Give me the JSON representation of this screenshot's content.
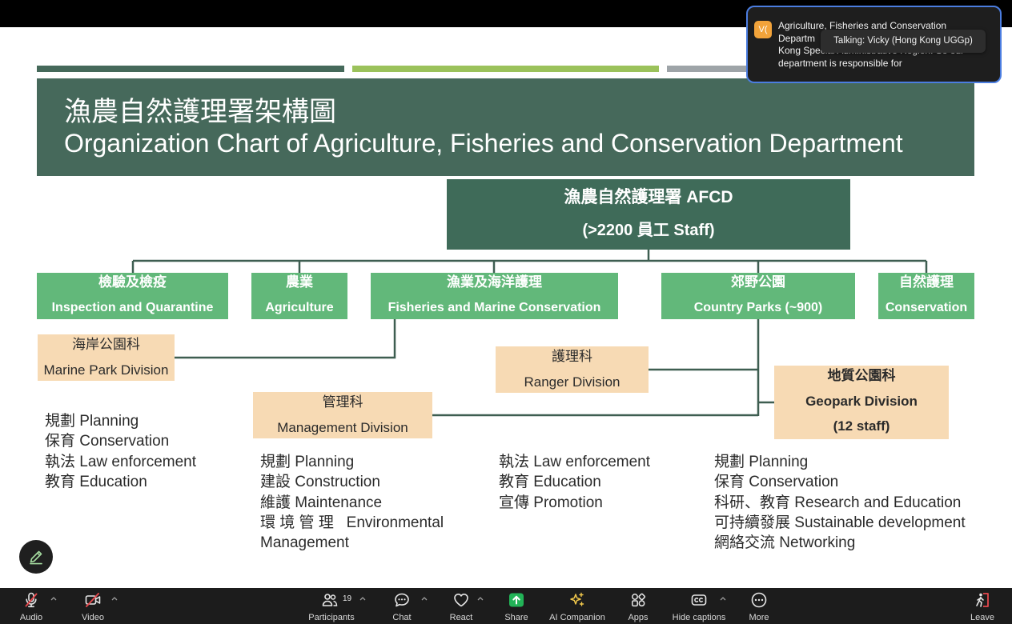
{
  "slide": {
    "colors": {
      "header": "#46695b",
      "root": "#3f6b59",
      "branch": "#62b87a",
      "division": "#f7dab4",
      "bar1": "#45695a",
      "bar2": "#9bc25b",
      "bar3": "#9ea4a8",
      "connector": "#3e5e51"
    },
    "title_zh": "漁農自然護理署架構圖",
    "title_en": "Organization Chart of Agriculture, Fisheries and Conservation Department",
    "root": {
      "name": "漁農自然護理署 AFCD",
      "staff": "(>2200 員工 Staff)"
    },
    "branches": [
      {
        "zh": "檢驗及檢疫",
        "en": "Inspection and Quarantine"
      },
      {
        "zh": "農業",
        "en": "Agriculture"
      },
      {
        "zh": "漁業及海洋護理",
        "en": "Fisheries and Marine Conservation"
      },
      {
        "zh": "郊野公園",
        "en": "Country Parks (~900)"
      },
      {
        "zh": "自然護理",
        "en": "Conservation"
      }
    ],
    "divisions": {
      "marine_park": {
        "zh": "海岸公園科",
        "en": "Marine Park Division"
      },
      "ranger": {
        "zh": "護理科",
        "en": "Ranger Division"
      },
      "management": {
        "zh": "管理科",
        "en": "Management Division"
      },
      "geopark": {
        "zh": "地質公園科",
        "en": "Geopark Division",
        "staff": "(12 staff)"
      }
    },
    "lists": {
      "marine_park": [
        "規劃 Planning",
        "保育 Conservation",
        "執法 Law enforcement",
        "教育 Education"
      ],
      "management": [
        "規劃 Planning",
        "建設 Construction",
        "維護 Maintenance",
        "環 境 管 理   Environmental",
        "Management"
      ],
      "ranger": [
        "執法 Law enforcement",
        "教育 Education",
        "宣傳 Promotion"
      ],
      "geopark": [
        "規劃 Planning",
        "保育 Conservation",
        "科研、教育 Research and Education",
        "可持續發展 Sustainable development",
        "網絡交流 Networking"
      ]
    }
  },
  "captions": {
    "avatar": "V(",
    "avatar_color": "#f2a33a",
    "border_color": "#4b7de0",
    "lines": [
      "Agriculture, Fisheries and Conservation",
      "Departm",
      "Kong Special Administrative Region. So our",
      "department is responsible for"
    ],
    "tooltip": "Talking: Vicky (Hong Kong UGGp)"
  },
  "edit_button": {
    "icon": "pencil-icon",
    "color": "#a5dca0"
  },
  "toolbar": {
    "audio": {
      "label": "Audio",
      "icon": "microphone-muted-icon"
    },
    "video": {
      "label": "Video",
      "icon": "video-muted-icon"
    },
    "participants": {
      "label": "Participants",
      "count": "19",
      "icon": "participants-icon"
    },
    "chat": {
      "label": "Chat",
      "icon": "chat-icon"
    },
    "react": {
      "label": "React",
      "icon": "heart-icon"
    },
    "share": {
      "label": "Share",
      "icon": "share-screen-icon",
      "color": "#22b357"
    },
    "ai_companion": {
      "label": "AI Companion",
      "icon": "sparkle-icon",
      "color": "#f2c94c"
    },
    "apps": {
      "label": "Apps",
      "icon": "apps-icon"
    },
    "captions": {
      "label": "Hide captions",
      "icon": "closed-captions-icon"
    },
    "more": {
      "label": "More",
      "icon": "more-icon"
    },
    "leave": {
      "label": "Leave",
      "icon": "leave-icon",
      "color": "#e5484d"
    }
  }
}
